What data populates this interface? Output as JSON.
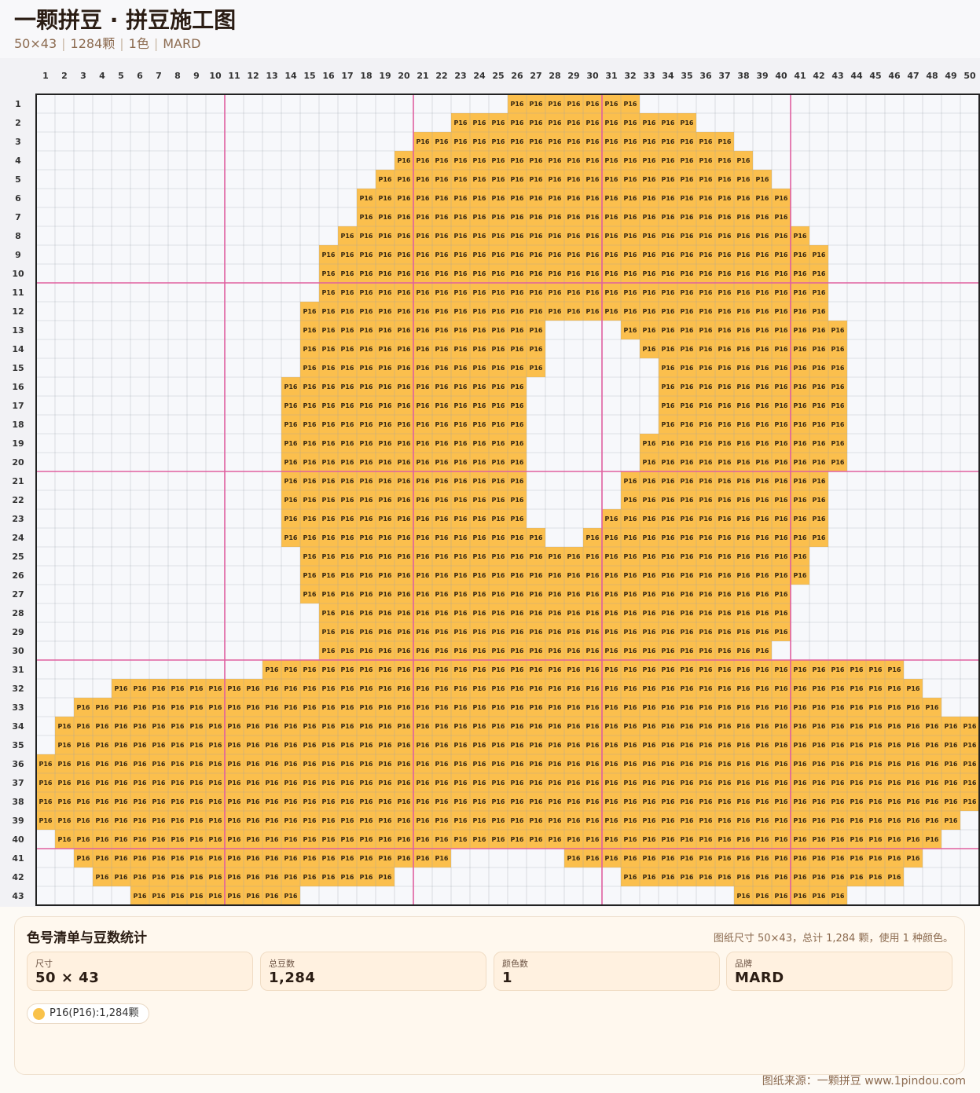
{
  "header": {
    "title": "一颗拼豆 · 拼豆施工图",
    "dims": "50×43",
    "count": "1284颗",
    "colors": "1色",
    "brand": "MARD"
  },
  "grid": {
    "cols": 50,
    "rows": 43,
    "major_every": 10,
    "bead_code": "P16",
    "bead_color": "#fbbf4d",
    "cell_text_color": "#3a2a12",
    "guide_line_color": "#e060a0",
    "rows_filled": [
      [
        [
          26,
          32
        ]
      ],
      [
        [
          23,
          35
        ]
      ],
      [
        [
          21,
          37
        ]
      ],
      [
        [
          20,
          38
        ]
      ],
      [
        [
          19,
          39
        ]
      ],
      [
        [
          18,
          40
        ]
      ],
      [
        [
          18,
          40
        ]
      ],
      [
        [
          17,
          41
        ]
      ],
      [
        [
          16,
          42
        ]
      ],
      [
        [
          16,
          42
        ]
      ],
      [
        [
          16,
          42
        ]
      ],
      [
        [
          15,
          42
        ]
      ],
      [
        [
          15,
          27
        ],
        [
          32,
          43
        ]
      ],
      [
        [
          15,
          27
        ],
        [
          33,
          43
        ]
      ],
      [
        [
          15,
          27
        ],
        [
          34,
          43
        ]
      ],
      [
        [
          14,
          26
        ],
        [
          34,
          43
        ]
      ],
      [
        [
          14,
          26
        ],
        [
          34,
          43
        ]
      ],
      [
        [
          14,
          26
        ],
        [
          34,
          43
        ]
      ],
      [
        [
          14,
          26
        ],
        [
          33,
          43
        ]
      ],
      [
        [
          14,
          26
        ],
        [
          33,
          43
        ]
      ],
      [
        [
          14,
          26
        ],
        [
          32,
          42
        ]
      ],
      [
        [
          14,
          26
        ],
        [
          32,
          42
        ]
      ],
      [
        [
          14,
          26
        ],
        [
          31,
          42
        ]
      ],
      [
        [
          14,
          27
        ],
        [
          30,
          42
        ]
      ],
      [
        [
          15,
          41
        ]
      ],
      [
        [
          15,
          41
        ]
      ],
      [
        [
          15,
          40
        ]
      ],
      [
        [
          16,
          40
        ]
      ],
      [
        [
          16,
          40
        ]
      ],
      [
        [
          16,
          39
        ]
      ],
      [
        [
          13,
          46
        ]
      ],
      [
        [
          5,
          47
        ]
      ],
      [
        [
          3,
          48
        ]
      ],
      [
        [
          2,
          50
        ]
      ],
      [
        [
          2,
          50
        ]
      ],
      [
        [
          1,
          50
        ]
      ],
      [
        [
          1,
          50
        ]
      ],
      [
        [
          1,
          50
        ]
      ],
      [
        [
          1,
          49
        ]
      ],
      [
        [
          2,
          48
        ]
      ],
      [
        [
          3,
          22
        ],
        [
          29,
          47
        ]
      ],
      [
        [
          4,
          19
        ],
        [
          32,
          46
        ]
      ],
      [
        [
          6,
          14
        ],
        [
          38,
          43
        ]
      ]
    ]
  },
  "panel": {
    "title": "色号清单与豆数统计",
    "summary": "图纸尺寸 50×43，总计 1,284 颗，使用 1 种颜色。",
    "stats": [
      {
        "label": "尺寸",
        "value": "50 × 43"
      },
      {
        "label": "总豆数",
        "value": "1,284"
      },
      {
        "label": "颜色数",
        "value": "1"
      },
      {
        "label": "品牌",
        "value": "MARD"
      }
    ],
    "legend": [
      {
        "text": "P16(P16):1,284颗",
        "color": "#f9c24a"
      }
    ]
  },
  "footer": "图纸来源：一颗拼豆 www.1pindou.com"
}
